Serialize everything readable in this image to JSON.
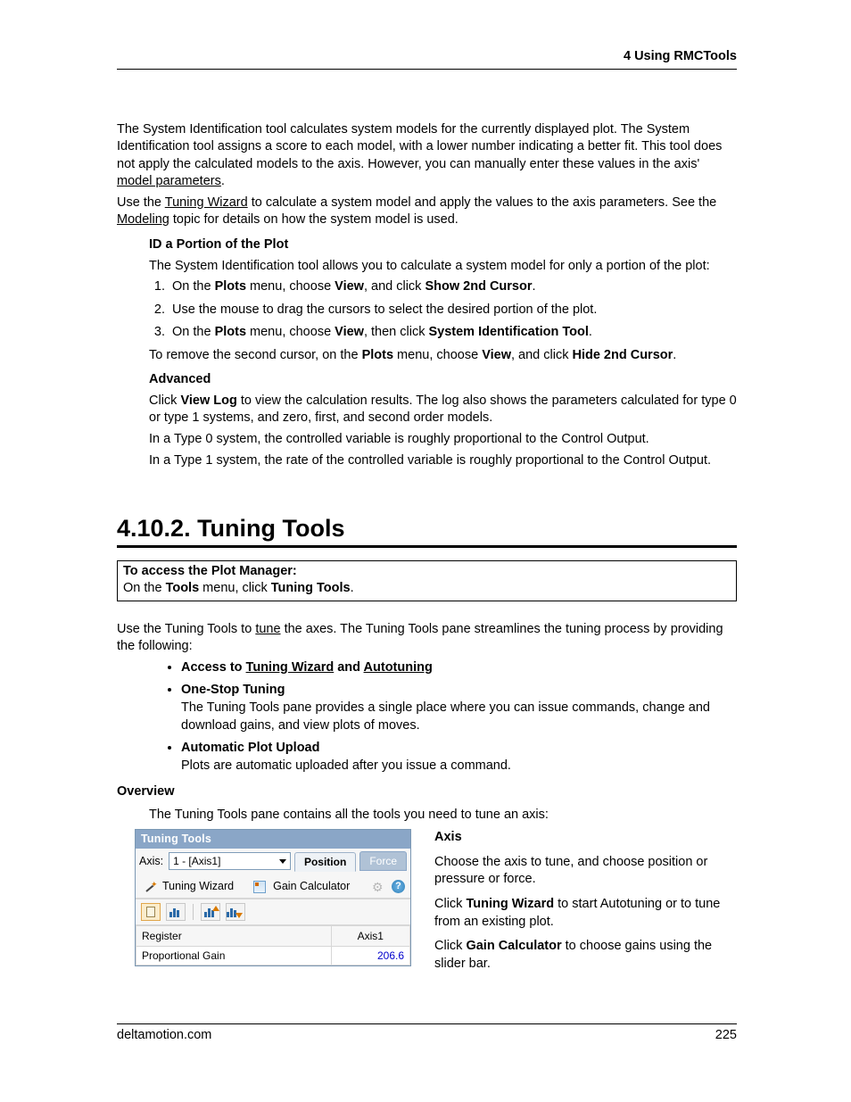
{
  "header": "4  Using RMCTools",
  "intro1_a": "The System Identification tool calculates system models for the currently displayed plot. The System Identification tool assigns a score to each model, with a lower number indicating a better fit. This tool does not apply the calculated models to the axis. However, you can manually enter these values in the axis' ",
  "intro1_link": "model parameters",
  "intro1_b": ".",
  "intro2_a": "Use the ",
  "intro2_link1": "Tuning Wizard",
  "intro2_b": " to calculate a system model and apply the values to the axis parameters. See the ",
  "intro2_link2": "Modeling",
  "intro2_c": " topic for details on how the system model is used.",
  "sub_id_heading": "ID a Portion of the Plot",
  "sub_id_intro": "The System Identification tool allows you to calculate a system model for only a portion of the plot:",
  "steps": {
    "s1a": "On the ",
    "s1b": "Plots",
    "s1c": " menu, choose ",
    "s1d": "View",
    "s1e": ", and click ",
    "s1f": "Show 2nd Cursor",
    "s1g": ".",
    "s2": "Use the mouse to drag the cursors to select the desired portion of the plot.",
    "s3a": "On the ",
    "s3b": "Plots",
    "s3c": " menu, choose ",
    "s3d": "View",
    "s3e": ", then click ",
    "s3f": "System Identification Tool",
    "s3g": "."
  },
  "remove_a": "To remove the second cursor, on the ",
  "remove_b": "Plots",
  "remove_c": " menu, choose ",
  "remove_d": "View",
  "remove_e": ", and click ",
  "remove_f": "Hide 2nd Cursor",
  "remove_g": ".",
  "adv_heading": "Advanced",
  "adv1a": "Click ",
  "adv1b": "View Log",
  "adv1c": " to view the calculation results. The log also shows the parameters calculated for type 0 or type 1 systems, and zero, first, and second order models.",
  "adv2": "In a Type 0 system, the controlled variable is roughly proportional to the Control Output.",
  "adv3": "In a Type 1 system, the rate of the controlled variable is roughly proportional to the Control Output.",
  "h2": "4.10.2. Tuning Tools",
  "access_h": "To access the Plot Manager:",
  "access_a": "On the ",
  "access_b": "Tools",
  "access_c": " menu, click ",
  "access_d": "Tuning Tools",
  "access_e": ".",
  "use_a": "Use the Tuning Tools to ",
  "use_link": "tune",
  "use_b": " the axes. The Tuning Tools pane streamlines the tuning process by providing the following:",
  "bul1a": "Access to ",
  "bul1b": "Tuning Wizard",
  "bul1c": " and ",
  "bul1d": "Autotuning",
  "bul2h": "One-Stop Tuning",
  "bul2t": "The Tuning Tools pane provides a single place where you can issue commands, change and download gains, and view plots of moves.",
  "bul3h": "Automatic Plot Upload",
  "bul3t": "Plots are automatic uploaded after you issue a command.",
  "overview_h": "Overview",
  "overview_t": "The Tuning Tools pane contains all the tools you need to tune an axis:",
  "panel": {
    "title": "Tuning Tools",
    "axis_label": "Axis:",
    "axis_value": "1 - [Axis1]",
    "tab_position": "Position",
    "tab_force": "Force",
    "tuning_wizard": "Tuning Wizard",
    "gain_calc": "Gain Calculator",
    "col_register": "Register",
    "col_axis": "Axis1",
    "row_name": "Proportional Gain",
    "row_val": "206.6"
  },
  "right": {
    "axis_h": "Axis",
    "axis_t": "Choose the axis to tune, and choose position or pressure or force.",
    "tw_a": "Click ",
    "tw_b": "Tuning Wizard",
    "tw_c": " to start Autotuning or to tune from an existing plot.",
    "gc_a": "Click ",
    "gc_b": "Gain Calculator",
    "gc_c": " to choose gains using the slider bar."
  },
  "footer_left": "deltamotion.com",
  "footer_right": "225"
}
